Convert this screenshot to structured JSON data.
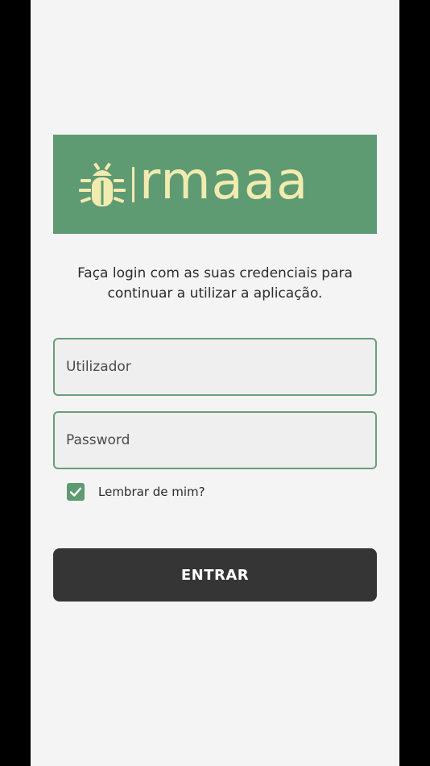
{
  "logo": {
    "text": "rmaaa",
    "icon": "bug-icon",
    "background_color": "#5e9a72",
    "foreground_color": "#f1ebb0"
  },
  "intro": {
    "text": "Faça login com as suas credenciais para continuar a utilizar a aplicação."
  },
  "form": {
    "username_placeholder": "Utilizador",
    "username_value": "",
    "password_placeholder": "Password",
    "password_value": "",
    "remember_label": "Lembrar de mim?",
    "remember_checked": true,
    "submit_label": "ENTRAR"
  },
  "colors": {
    "accent": "#5e9a72",
    "button": "#353535",
    "background": "#f4f4f4"
  }
}
